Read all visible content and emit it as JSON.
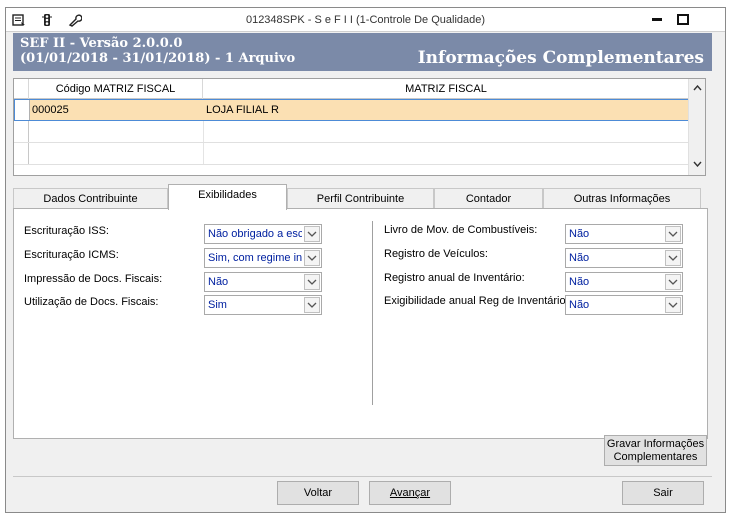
{
  "window": {
    "title": "012348SPK - S e F  I I (1-Controle De Qualidade)",
    "icons": [
      "menu-icon",
      "traffic-light-icon",
      "wrench-icon"
    ]
  },
  "header": {
    "line1": "SEF II - Versão 2.0.0.0",
    "line2": "(01/01/2018 - 31/01/2018) - 1 Arquivo",
    "section_title": "Informações Complementares"
  },
  "grid": {
    "columns": [
      "Código MATRIZ FISCAL",
      "MATRIZ FISCAL"
    ],
    "rows": [
      {
        "codigo": "000025",
        "matriz": "LOJA FILIAL R"
      }
    ]
  },
  "tabs": [
    {
      "label": "Dados Contribuinte"
    },
    {
      "label": "Exibilidades"
    },
    {
      "label": "Perfil Contribuinte"
    },
    {
      "label": "Contador"
    },
    {
      "label": "Outras Informações"
    }
  ],
  "form": {
    "left": [
      {
        "label": "Escrituração ISS:",
        "value": "Não obrigado a escr"
      },
      {
        "label": "Escrituração ICMS:",
        "value": "Sim, com regime inte"
      },
      {
        "label": "Impressão de Docs. Fiscais:",
        "value": "Não"
      },
      {
        "label": "Utilização de Docs. Fiscais:",
        "value": "Sim"
      }
    ],
    "right": [
      {
        "label": "Livro de Mov. de Combustíveis:",
        "value": "Não"
      },
      {
        "label": "Registro de Veículos:",
        "value": "Não"
      },
      {
        "label": "Registro anual de Inventário:",
        "value": "Não"
      },
      {
        "label": "Exigibilidade anual Reg de Inventário:",
        "value": "Não"
      }
    ]
  },
  "buttons": {
    "gravar_line1": "Gravar Informações",
    "gravar_line2": "Complementares",
    "voltar": "Voltar",
    "avancar": "Avançar",
    "sair": "Sair"
  },
  "colors": {
    "header_bg": "#7b8aa8",
    "selected_row": "#fbe0b3",
    "combo_text": "#0020a0"
  }
}
